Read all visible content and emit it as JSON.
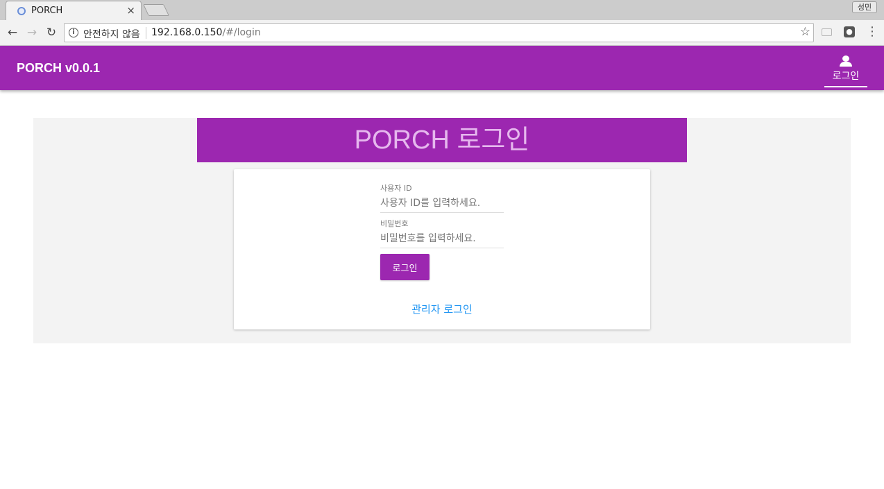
{
  "browser": {
    "tab_title": "PORCH",
    "tab_close": "×",
    "profile_label": "성민",
    "security_text": "안전하지 않음",
    "url_host": "192.168.0.150",
    "url_path": "/#/login"
  },
  "appbar": {
    "title": "PORCH v0.0.1",
    "login_label": "로그인",
    "color": "#9c27b0"
  },
  "login": {
    "banner_title": "PORCH 로그인",
    "user_id_label": "사용자 ID",
    "user_id_placeholder": "사용자 ID를 입력하세요.",
    "password_label": "비밀번호",
    "password_placeholder": "비밀번호를 입력하세요.",
    "submit_label": "로그인",
    "admin_link": "관리자 로그인",
    "link_color": "#2196f3"
  }
}
